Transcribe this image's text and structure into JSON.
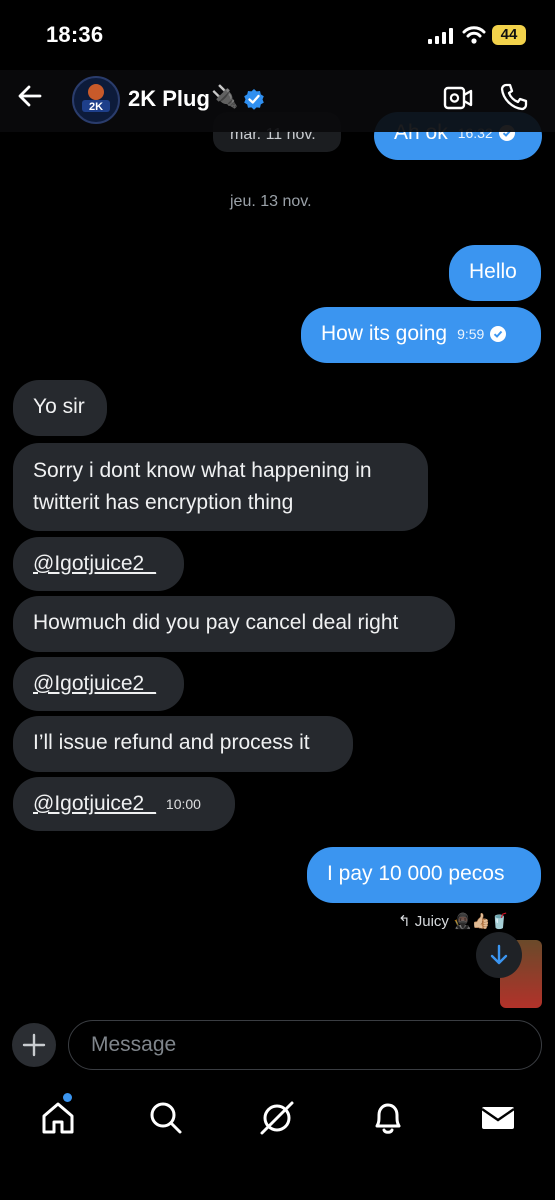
{
  "status": {
    "time": "18:36",
    "battery": "44"
  },
  "header": {
    "title": "2K Plug",
    "title_emoji": "🔌",
    "avatar_text": "2K"
  },
  "dates": {
    "d1": "mar. 11 nov.",
    "d2": "jeu. 13 nov."
  },
  "messages": {
    "m0": {
      "text": "Ah ok",
      "time": "16:32"
    },
    "m1": {
      "text": "Hello"
    },
    "m2": {
      "text": "How its going",
      "time": "9:59"
    },
    "m3": {
      "text": "Yo sir"
    },
    "m4": {
      "line1": "Sorry i dont know what happening in",
      "line2": "twitterit has encryption thing"
    },
    "m5": {
      "text": "@Igotjuice2_"
    },
    "m6": {
      "text": "Howmuch did you pay cancel deal  right"
    },
    "m7": {
      "text": "@Igotjuice2_"
    },
    "m8": {
      "text": "I’ll issue refund and process it"
    },
    "m9": {
      "text": "@Igotjuice2_",
      "time": "10:00"
    },
    "m10": {
      "text": "I pay 10 000 pecos"
    }
  },
  "reactions": {
    "text": "↰ Juicy 🥷🏿👍🏼🥤"
  },
  "composer": {
    "placeholder": "Message"
  },
  "colors": {
    "outgoing": "#3b95f0",
    "incoming": "#26292e",
    "background": "#000000"
  },
  "icons": [
    "back-arrow-icon",
    "verified-badge-icon",
    "video-call-icon",
    "phone-icon",
    "plus-icon",
    "home-icon",
    "search-icon",
    "grok-icon",
    "bell-icon",
    "mail-icon",
    "chevron-down-icon"
  ]
}
